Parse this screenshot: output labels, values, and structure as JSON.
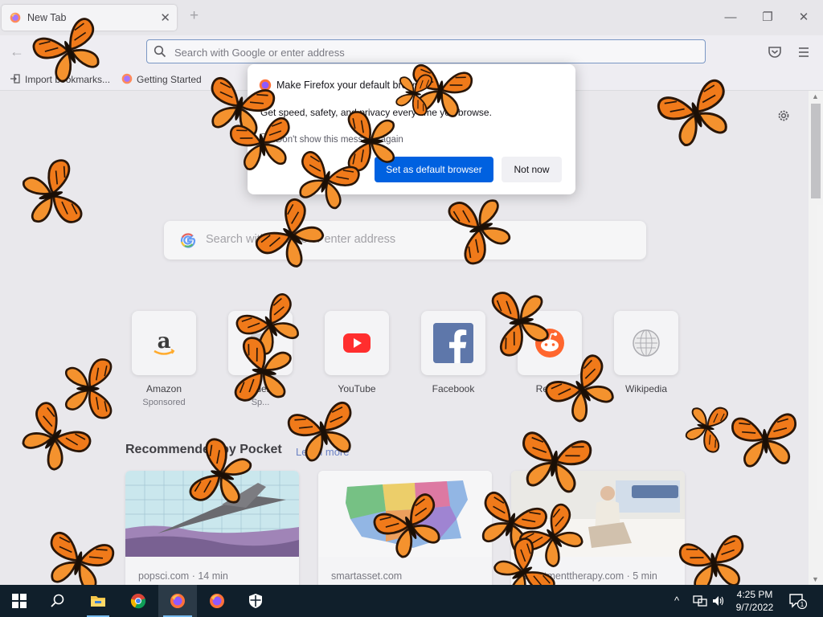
{
  "browser": {
    "tab": {
      "title": "New Tab",
      "close_glyph": "✕",
      "favicon": "firefox-icon"
    },
    "new_tab_glyph": "+",
    "window_controls": {
      "minimize": "—",
      "maximize": "❐",
      "close": "✕"
    },
    "nav": {
      "back_glyph": "←"
    },
    "urlbar": {
      "placeholder": "Search with Google or enter address"
    },
    "bookmarks": [
      {
        "label": "Import bookmarks...",
        "icon": "import-icon"
      },
      {
        "label": "Getting Started",
        "icon": "firefox-icon"
      }
    ]
  },
  "newtab": {
    "search_placeholder": "Search with Google or enter address",
    "shortcuts": [
      {
        "label": "Amazon",
        "sub": "Sponsored",
        "icon": "amazon-logo"
      },
      {
        "label": "Under...",
        "sub": "Sp...",
        "icon": "site-icon"
      },
      {
        "label": "YouTube",
        "sub": "",
        "icon": "youtube-logo"
      },
      {
        "label": "Facebook",
        "sub": "",
        "icon": "facebook-logo"
      },
      {
        "label": "Reddit",
        "sub": "",
        "icon": "reddit-logo"
      },
      {
        "label": "Wikipedia",
        "sub": "",
        "icon": "wikipedia-logo"
      }
    ],
    "pocket": {
      "title": "Recommended by Pocket",
      "learn_more": "Learn more",
      "cards": [
        {
          "source": "popsci.com · 14 min"
        },
        {
          "source": "smartasset.com"
        },
        {
          "source": "apartmenttherapy.com · 5 min"
        }
      ]
    }
  },
  "dialog": {
    "title": "Make Firefox your default browser?",
    "description": "Get speed, safety, and privacy every time you browse.",
    "checkbox_label": "Don't show this message again",
    "primary_button": "Set as default browser",
    "secondary_button": "Not now"
  },
  "taskbar": {
    "apps": [
      "windows-start",
      "search",
      "file-explorer",
      "chrome",
      "firefox",
      "firefox",
      "windows-security"
    ],
    "tray_up": "^",
    "clock": {
      "time": "4:25 PM",
      "date": "9/7/2022"
    },
    "notification_count": "1"
  },
  "colors": {
    "accent": "#0061e0",
    "butterfly_orange": "#f07a1a",
    "taskbar": "#101f2b"
  }
}
